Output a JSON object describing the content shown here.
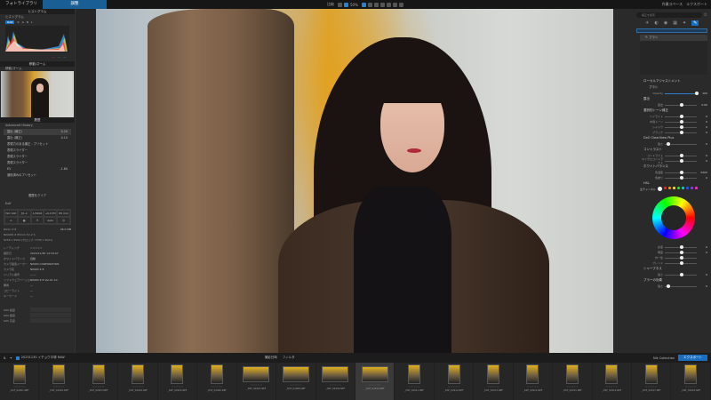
{
  "topbar": {
    "tabs": [
      "フォトライブラリ",
      "調整"
    ],
    "active_tab": 1,
    "compare_label": "比較",
    "zoom_label": "50%",
    "workspace_label": "作業スペース",
    "export_label": "エクスポート"
  },
  "left": {
    "histogram": {
      "panel_title": "ヒストグラム",
      "sub_title": "ヒストグラム",
      "channels": [
        "RGB",
        "R",
        "G",
        "B",
        "L"
      ],
      "values": {
        "r": "---",
        "g": "---",
        "b": "---"
      }
    },
    "navigator": {
      "panel_title": "移動/ズーム",
      "sub_title": "移動/ズーム"
    },
    "history": {
      "panel_title": "履歴",
      "sub_title": "Advanced History",
      "items": [
        {
          "label": "露出 (補正)",
          "value": "0.20"
        },
        {
          "label": "露出 (補正)",
          "value": "0.10"
        },
        {
          "label": "表現力のある補正 - プリセット",
          "value": ""
        },
        {
          "label": "表現スライダー",
          "value": ""
        },
        {
          "label": "表現スライダー",
          "value": ""
        },
        {
          "label": "表現スライダー",
          "value": ""
        },
        {
          "label": "EV",
          "value": "-1.60"
        },
        {
          "label": "適用済みのプリセット",
          "value": ""
        }
      ],
      "bottom_button": "履歴をクリア"
    },
    "exif": {
      "title": "Exif",
      "cells": [
        "ISO 100",
        "ƒ/1.2",
        "1/3200 s",
        "+0.0 EV",
        "85 mm"
      ],
      "camera": "Nikon Z 8",
      "file_size": "46.0 MB",
      "lens": "NIKKOR Z 85mm f/1.2 S",
      "dimensions": "8256 x 5504 (クロップ: 7735 x 5021)",
      "fields": [
        {
          "label": "レーティング",
          "value": "☆☆☆☆☆"
        },
        {
          "label": "撮影日",
          "value": "2023/11/30 14:54:07"
        },
        {
          "label": "ホワイトバランス",
          "value": "自動"
        },
        {
          "label": "カメラ製造メーカー",
          "value": "NIKON CORPORATION"
        },
        {
          "label": "カメラ名",
          "value": "NIKON Z 8"
        },
        {
          "label": "シリアル番号",
          "value": "------"
        },
        {
          "label": "ソフトウェアバージョン",
          "value": "NIKON Z 8 Ver.01.10"
        },
        {
          "label": "著者",
          "value": "—"
        },
        {
          "label": "コピーライト",
          "value": "—"
        },
        {
          "label": "キーワード",
          "value": "—"
        }
      ],
      "gps": [
        "GPS 緯度",
        "GPS 経度",
        "GPS 高度"
      ]
    }
  },
  "right": {
    "search_placeholder": "補正を検索",
    "mask_layer": "ブラシ",
    "local_adjust_title": "ローカルアジャストメント",
    "brush_label": "ブラシ",
    "opacity": {
      "label": "Opacity",
      "value": 100
    },
    "sections": [
      {
        "title": "露出",
        "sliders": [
          {
            "label": "露出",
            "value": "0.00",
            "pos": 0.5
          }
        ]
      },
      {
        "title": "選択的トーン補正",
        "sliders": [
          {
            "label": "ハイライト",
            "value": "0",
            "pos": 0.5
          },
          {
            "label": "中間トーン",
            "value": "0",
            "pos": 0.5
          },
          {
            "label": "シャドウ",
            "value": "0",
            "pos": 0.5
          },
          {
            "label": "ブラック",
            "value": "0",
            "pos": 0.5
          }
        ]
      },
      {
        "title": "DxO ClearView Plus",
        "sliders": [
          {
            "label": "強さ",
            "value": "0",
            "pos": 0.05
          }
        ]
      },
      {
        "title": "コントラスト",
        "sliders": [
          {
            "label": "コントラスト",
            "value": "0",
            "pos": 0.5
          },
          {
            "label": "マイクロコントラスト",
            "value": "0",
            "pos": 0.5
          }
        ]
      },
      {
        "title": "ホワイトバランス",
        "sliders": [
          {
            "label": "色温度",
            "value": "5200",
            "pos": 0.5
          },
          {
            "label": "色被り",
            "value": "0",
            "pos": 0.5
          }
        ]
      }
    ],
    "hsl": {
      "title": "HSL",
      "channel_label": "全チャンネル",
      "swatches": [
        "#ffffff",
        "#ff2020",
        "#ff9900",
        "#ffee00",
        "#33dd33",
        "#00dddd",
        "#2255ff",
        "#9933ff",
        "#ff33cc"
      ],
      "sliders": [
        {
          "label": "彩度",
          "value": "0"
        },
        {
          "label": "明度",
          "value": "0"
        },
        {
          "label": "均一性",
          "value": ""
        },
        {
          "label": "ブレンド",
          "value": ""
        }
      ]
    },
    "sharpness": {
      "title": "シャープネス",
      "sliders": [
        {
          "label": "強さ",
          "value": "0",
          "pos": 0.5
        }
      ]
    },
    "blur": {
      "title": "ブラーの効果",
      "sliders": [
        {
          "label": "強さ",
          "value": "0",
          "pos": 0.05
        }
      ]
    }
  },
  "filmstrip": {
    "folder": "20231130 イチョウ平塚 RAW",
    "sort_label": "撮影日時",
    "filter_label": "フィルタ",
    "nik_label": "Nik Collection",
    "export_label": "エクスポート",
    "items": [
      "_DSF_02901.NEF",
      "_DSF_02902.NEF",
      "_DSF_02903.NEF",
      "_DSF_02904.NEF",
      "_DSF_02905.NEF",
      "_DSF_02906.NEF",
      "_DSF_02907.NEF",
      "_DSF_02908.NEF",
      "_DSF_02909.NEF",
      "_DSF_02910.NEF",
      "_DSF_02911.NEF",
      "_DSF_02912.NEF",
      "_DSF_02913.NEF",
      "_DSF_02914.NEF",
      "_DSF_02915.NEF",
      "_DSF_02916.NEF",
      "_DSF_02917.NEF",
      "_DSF_02918.NEF"
    ],
    "selected_index": 9
  }
}
